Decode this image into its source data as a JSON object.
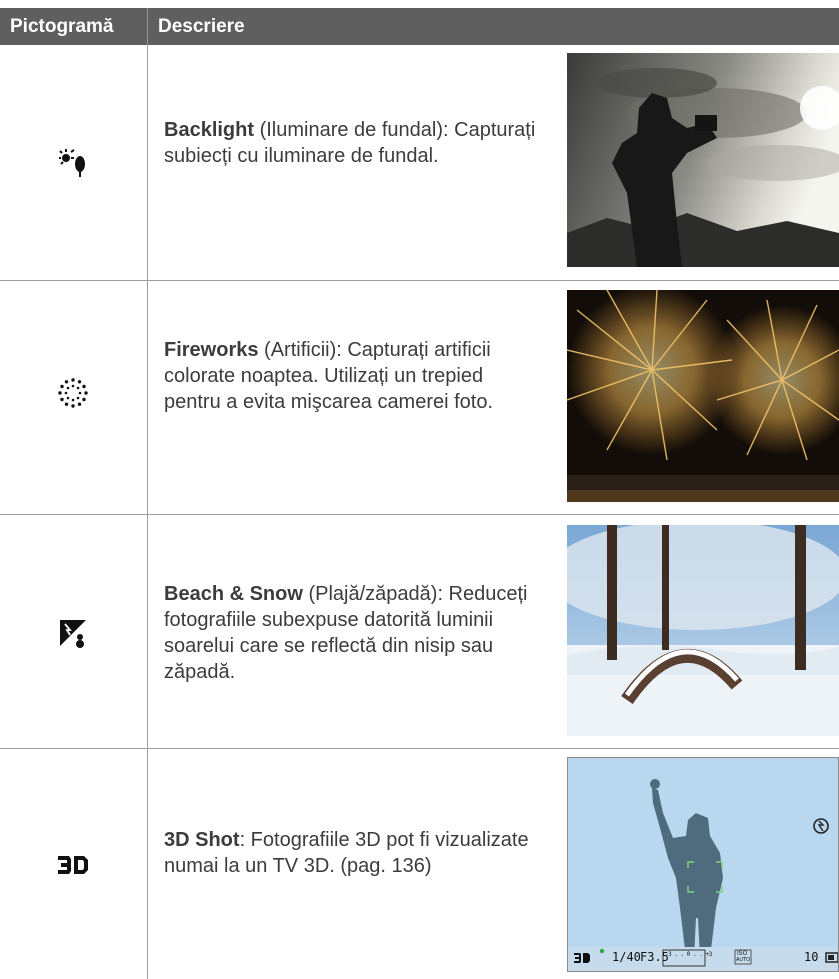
{
  "table": {
    "headers": {
      "icon_col": "Pictogramă",
      "desc_col": "Descriere"
    },
    "rows": [
      {
        "icon": "backlight-icon",
        "title": "Backlight",
        "text": " (Iluminare de fundal): Capturați subiecți cu iluminare de fundal.",
        "photo": "backlight-silhouette-photo"
      },
      {
        "icon": "fireworks-icon",
        "title": "Fireworks",
        "text": " (Artificii): Capturați artificii colorate noaptea. Utilizați un trepied pentru a evita mişcarea camerei foto.",
        "photo": "fireworks-photo"
      },
      {
        "icon": "beach-snow-icon",
        "title": "Beach & Snow",
        "text": " (Plajă/zăpadă): Reduceți fotografiile subexpuse datorită luminii soarelui care se reflectă din nisip sau zăpadă.",
        "photo": "snow-scene-photo"
      },
      {
        "icon": "3d-icon",
        "title": "3D Shot",
        "text": ": Fotografiile 3D pot fi vizualizate numai la un TV 3D. (pag. 136)",
        "photo": "3d-camera-screen-photo"
      }
    ]
  },
  "camera_screen": {
    "shutter": "1/40",
    "aperture": "F3.5",
    "exposure_scale": "-3 . . 0 . . +3",
    "iso_top": "ISO",
    "iso_value": "AUTO",
    "shots_left": "10"
  }
}
